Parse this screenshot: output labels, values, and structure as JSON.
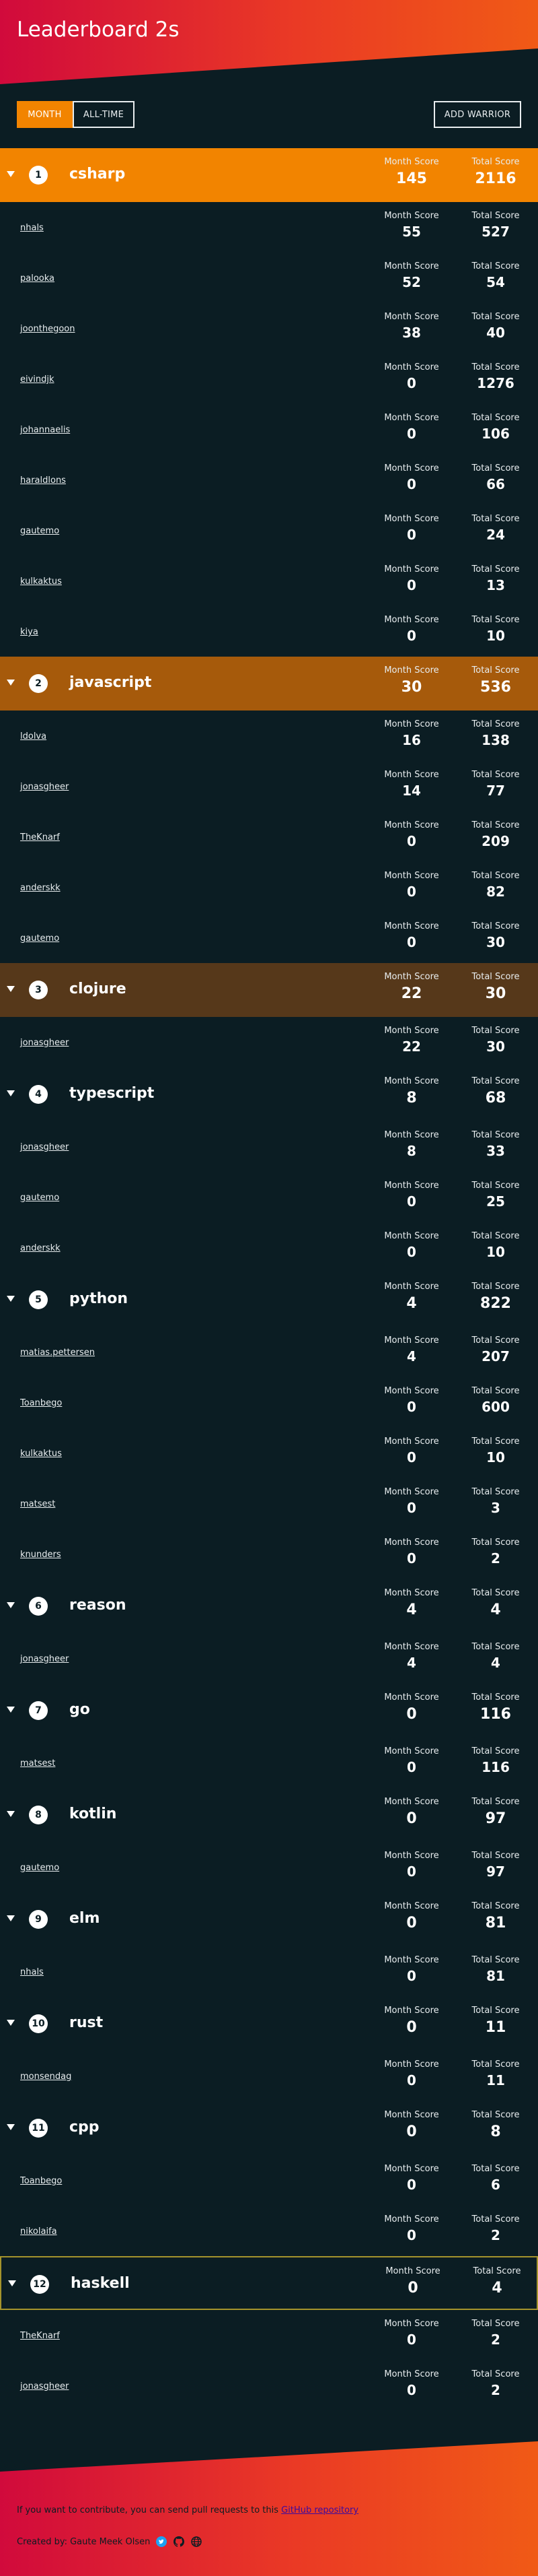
{
  "title": "Leaderboard 2s",
  "toolbar": {
    "month_label": "MONTH",
    "alltime_label": "ALL-TIME",
    "add_label": "ADD WARRIOR"
  },
  "labels": {
    "month_score": "Month Score",
    "total_score": "Total Score"
  },
  "languages": [
    {
      "rank": "1",
      "name": "csharp",
      "month": "145",
      "total": "2116",
      "members": [
        {
          "name": "nhals",
          "month": "55",
          "total": "527"
        },
        {
          "name": "palooka",
          "month": "52",
          "total": "54"
        },
        {
          "name": "joonthegoon",
          "month": "38",
          "total": "40"
        },
        {
          "name": "eivindjk",
          "month": "0",
          "total": "1276"
        },
        {
          "name": "johannaelis",
          "month": "0",
          "total": "106"
        },
        {
          "name": "haraldlons",
          "month": "0",
          "total": "66"
        },
        {
          "name": "gautemo",
          "month": "0",
          "total": "24"
        },
        {
          "name": "kulkaktus",
          "month": "0",
          "total": "13"
        },
        {
          "name": "kiya",
          "month": "0",
          "total": "10"
        }
      ]
    },
    {
      "rank": "2",
      "name": "javascript",
      "month": "30",
      "total": "536",
      "members": [
        {
          "name": "ldolva",
          "month": "16",
          "total": "138"
        },
        {
          "name": "jonasgheer",
          "month": "14",
          "total": "77"
        },
        {
          "name": "TheKnarf",
          "month": "0",
          "total": "209"
        },
        {
          "name": "anderskk",
          "month": "0",
          "total": "82"
        },
        {
          "name": "gautemo",
          "month": "0",
          "total": "30"
        }
      ]
    },
    {
      "rank": "3",
      "name": "clojure",
      "month": "22",
      "total": "30",
      "members": [
        {
          "name": "jonasgheer",
          "month": "22",
          "total": "30"
        }
      ]
    },
    {
      "rank": "4",
      "name": "typescript",
      "month": "8",
      "total": "68",
      "members": [
        {
          "name": "jonasgheer",
          "month": "8",
          "total": "33"
        },
        {
          "name": "gautemo",
          "month": "0",
          "total": "25"
        },
        {
          "name": "anderskk",
          "month": "0",
          "total": "10"
        }
      ]
    },
    {
      "rank": "5",
      "name": "python",
      "month": "4",
      "total": "822",
      "members": [
        {
          "name": "matias.pettersen",
          "month": "4",
          "total": "207"
        },
        {
          "name": "Toanbego",
          "month": "0",
          "total": "600"
        },
        {
          "name": "kulkaktus",
          "month": "0",
          "total": "10"
        },
        {
          "name": "matsest",
          "month": "0",
          "total": "3"
        },
        {
          "name": "knunders",
          "month": "0",
          "total": "2"
        }
      ]
    },
    {
      "rank": "6",
      "name": "reason",
      "month": "4",
      "total": "4",
      "members": [
        {
          "name": "jonasgheer",
          "month": "4",
          "total": "4"
        }
      ]
    },
    {
      "rank": "7",
      "name": "go",
      "month": "0",
      "total": "116",
      "members": [
        {
          "name": "matsest",
          "month": "0",
          "total": "116"
        }
      ]
    },
    {
      "rank": "8",
      "name": "kotlin",
      "month": "0",
      "total": "97",
      "members": [
        {
          "name": "gautemo",
          "month": "0",
          "total": "97"
        }
      ]
    },
    {
      "rank": "9",
      "name": "elm",
      "month": "0",
      "total": "81",
      "members": [
        {
          "name": "nhals",
          "month": "0",
          "total": "81"
        }
      ]
    },
    {
      "rank": "10",
      "name": "rust",
      "month": "0",
      "total": "11",
      "members": [
        {
          "name": "monsendag",
          "month": "0",
          "total": "11"
        }
      ]
    },
    {
      "rank": "11",
      "name": "cpp",
      "month": "0",
      "total": "8",
      "members": [
        {
          "name": "Toanbego",
          "month": "0",
          "total": "6"
        },
        {
          "name": "nikolaifa",
          "month": "0",
          "total": "2"
        }
      ]
    },
    {
      "rank": "12",
      "name": "haskell",
      "month": "0",
      "total": "4",
      "members": [
        {
          "name": "TheKnarf",
          "month": "0",
          "total": "2"
        },
        {
          "name": "jonasgheer",
          "month": "0",
          "total": "2"
        }
      ]
    }
  ],
  "footer": {
    "contrib_text": "If you want to contribute, you can send pull requests to this ",
    "contrib_link": "GitHub repository",
    "credit_text": "Created by: Gaute Meek Olsen"
  },
  "colors": {
    "accent": "#f28400",
    "rank2": "#a65a0b",
    "rank3": "#56381a",
    "background": "#0b1d23"
  }
}
